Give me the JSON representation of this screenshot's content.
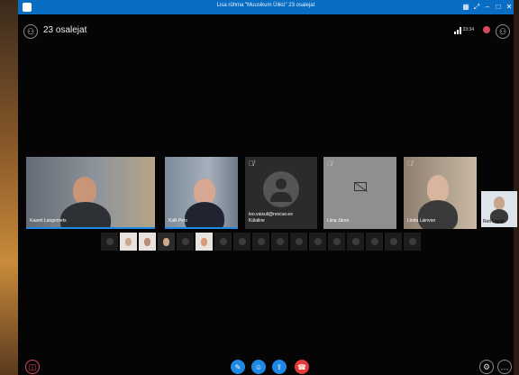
{
  "window": {
    "title": "Lisa rühma \"Muusikum Ülikü\" 23 osalejat"
  },
  "header": {
    "participants_label": "23 osalejat",
    "time_text": "33:34"
  },
  "tiles": [
    {
      "name": "Kaarel Langemets",
      "speaking": true
    },
    {
      "name": "Kalli Pets",
      "speaking": true
    },
    {
      "name": "leo.vaisuli@rescue.ee",
      "name2": "Külaline",
      "muted": true
    },
    {
      "name": "Liina Järes",
      "muted": true,
      "camera_off": true
    },
    {
      "name": "Linda Lainvoo",
      "muted": true
    },
    {
      "name": "Reti Lepist"
    }
  ],
  "icons": {
    "app": "skype-app-icon",
    "participants": "participants-icon",
    "record": "record-icon",
    "settings": "settings-icon",
    "chat": "chat-icon",
    "mic": "microphone-icon",
    "video": "video-icon",
    "share": "share-screen-icon",
    "hangup": "hang-up-icon",
    "more": "more-options-icon"
  },
  "colors": {
    "titlebar": "#0a6dc4",
    "hangup": "#e53935",
    "control": "#1e88e5"
  }
}
